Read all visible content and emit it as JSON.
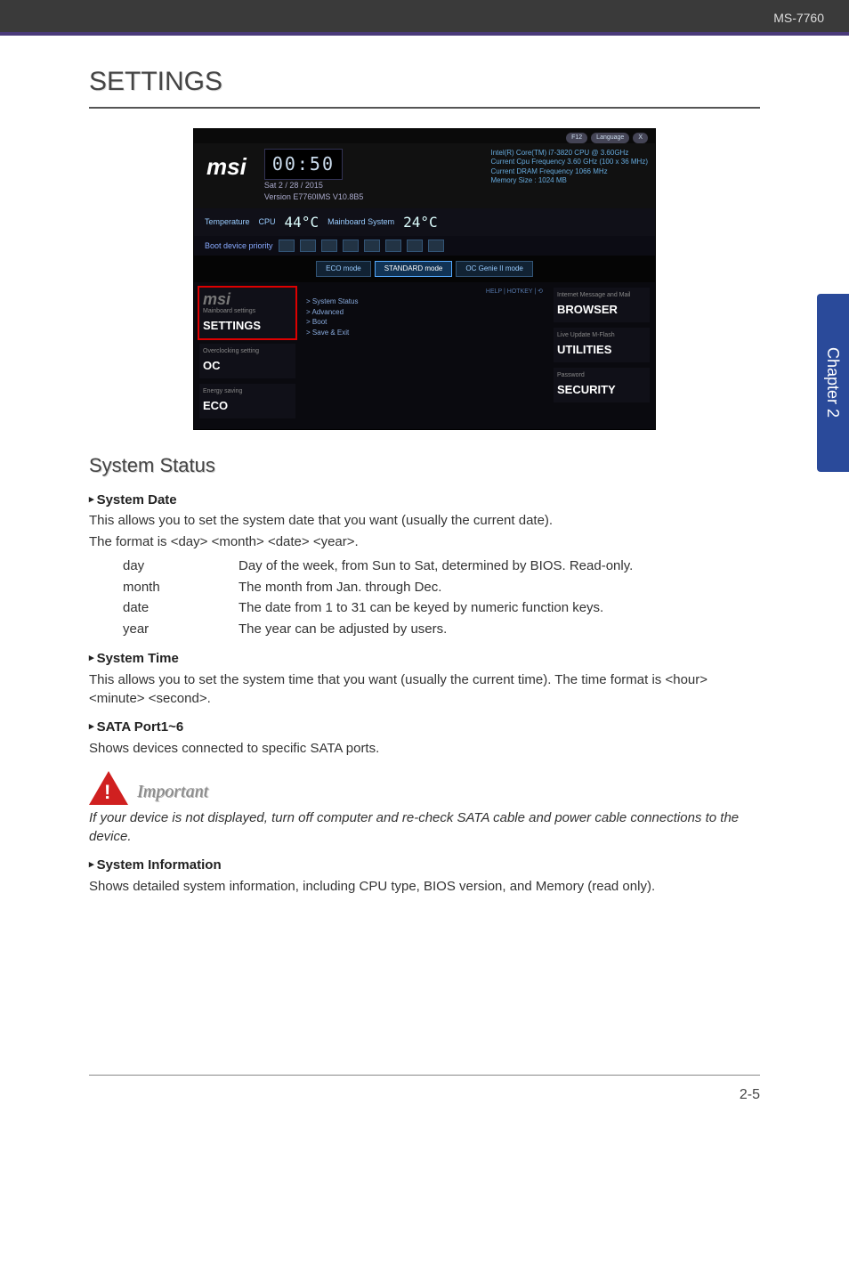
{
  "header": {
    "model": "MS-7760"
  },
  "sidetab": {
    "label": "Chapter 2"
  },
  "title": "SETTINGS",
  "bios": {
    "logo": "msi",
    "time_display": "00:50",
    "date_line": "Sat  2 / 28 / 2015",
    "version_line": "Version E7760IMS V10.8B5",
    "cpu_line": "Intel(R) Core(TM) i7-3820 CPU @ 3.60GHz",
    "freq_line": "Current Cpu Frequency 3.60 GHz (100 x 36 MHz)",
    "dram_line": "Current DRAM Frequency 1066 MHz",
    "mem_line": "Memory Size : 1024 MB",
    "temp_label": "Temperature",
    "cpu_label": "CPU",
    "cpu_temp": "44°C",
    "mb_label": "Mainboard\nSystem",
    "mb_temp": "24°C",
    "boot_label": "Boot device priority",
    "pills": [
      "F12",
      "Language",
      "X"
    ],
    "modes": {
      "eco": "ECO\nmode",
      "standard": "STANDARD\nmode",
      "ocgenie": "OC Genie II\nmode"
    },
    "help_label": "HELP | HOTKEY | ⟲",
    "menu": [
      "System Status",
      "Advanced",
      "Boot",
      "Save & Exit"
    ],
    "left_tiles": [
      {
        "sub": "Mainboard settings",
        "label": "SETTINGS",
        "sel": true
      },
      {
        "sub": "Overclocking setting",
        "label": "OC",
        "sel": false
      },
      {
        "sub": "Energy saving",
        "label": "ECO",
        "sel": false
      }
    ],
    "right_tiles": [
      {
        "sub": "Internet\nMessage and Mail",
        "label": "BROWSER"
      },
      {
        "sub": "Live Update\nM-Flash",
        "label": "UTILITIES"
      },
      {
        "sub": "Password",
        "label": "SECURITY"
      }
    ]
  },
  "section_heading": "System Status",
  "items": {
    "sys_date": {
      "hd": "System Date",
      "p1": "This allows you to set the system date that you want (usually the current date).",
      "p2": "The format is <day> <month> <date> <year>.",
      "rows": [
        {
          "k": "day",
          "v": "Day of the week, from Sun to Sat, determined by BIOS. Read-only."
        },
        {
          "k": "month",
          "v": "The month from Jan. through Dec."
        },
        {
          "k": "date",
          "v": "The date from 1 to 31 can be keyed by numeric function keys."
        },
        {
          "k": "year",
          "v": "The year can be adjusted by users."
        }
      ]
    },
    "sys_time": {
      "hd": "System Time",
      "p": "This allows you to set the system time that you want (usually the current time). The time format is <hour> <minute> <second>."
    },
    "sata": {
      "hd": "SATA Port1~6",
      "p": "Shows devices connected to specific SATA ports."
    },
    "important": {
      "label": "Important",
      "p": "If your device is not displayed, turn off computer and re-check SATA cable and power cable connections to the device."
    },
    "sys_info": {
      "hd": "System Information",
      "p": "Shows detailed system information, including CPU type, BIOS version, and Memory (read only)."
    }
  },
  "footer": {
    "page": "2-5"
  }
}
